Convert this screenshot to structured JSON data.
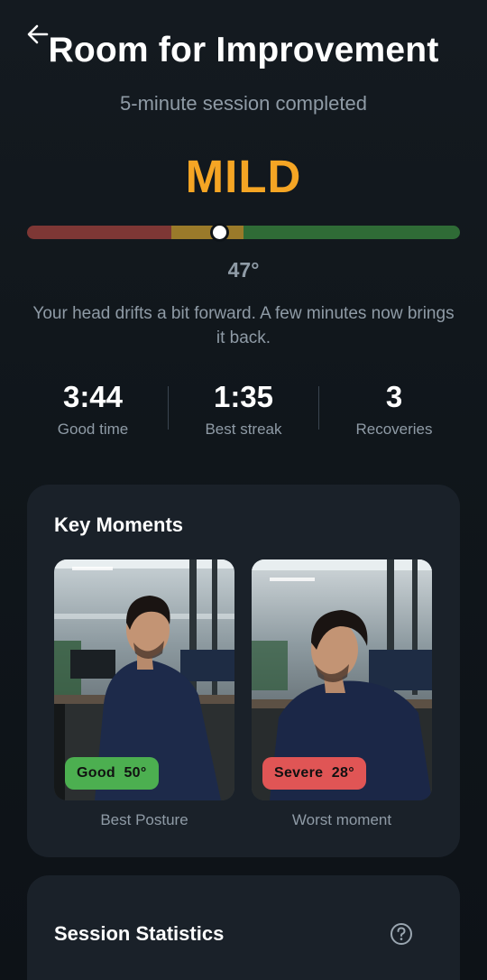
{
  "header": {
    "title": "Room for Improvement",
    "subtitle": "5-minute session completed"
  },
  "result": {
    "severity": "MILD",
    "severity_color": "#f5a524",
    "angle": "47°",
    "gauge_position": 0.443,
    "message": "Your head drifts a bit forward. A few minutes now brings it back."
  },
  "stats": [
    {
      "value": "3:44",
      "label": "Good time"
    },
    {
      "value": "1:35",
      "label": "Best streak"
    },
    {
      "value": "3",
      "label": "Recoveries"
    }
  ],
  "key_moments": {
    "title": "Key Moments",
    "items": [
      {
        "badge_status": "Good",
        "badge_angle": "50°",
        "badge_color": "#4caf50",
        "caption": "Best Posture"
      },
      {
        "badge_status": "Severe",
        "badge_angle": "28°",
        "badge_color": "#e05555",
        "caption": "Worst moment"
      }
    ]
  },
  "session_statistics": {
    "title": "Session Statistics",
    "help_icon": "question-circle-icon"
  },
  "icons": {
    "back": "arrow-left-icon"
  }
}
